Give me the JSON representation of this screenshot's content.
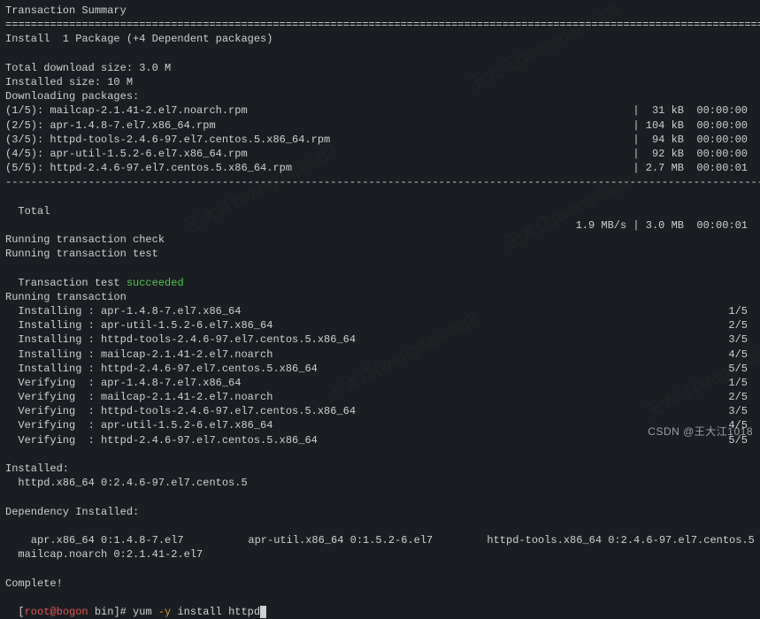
{
  "header": "Transaction Summary",
  "sep_double": "================================================================================================================================",
  "sep_dash": "--------------------------------------------------------------------------------------------------------------------------------",
  "install_line": "Install  1 Package (+4 Dependent packages)",
  "download_size": "Total download size: 3.0 M",
  "installed_size": "Installed size: 10 M",
  "downloading": "Downloading packages:",
  "pkgs": [
    {
      "idx": "(1/5):",
      "name": "mailcap-2.1.41-2.el7.noarch.rpm",
      "size": " 31 kB",
      "time": "00:00:00"
    },
    {
      "idx": "(2/5):",
      "name": "apr-1.4.8-7.el7.x86_64.rpm",
      "size": "104 kB",
      "time": "00:00:00"
    },
    {
      "idx": "(3/5):",
      "name": "httpd-tools-2.4.6-97.el7.centos.5.x86_64.rpm",
      "size": " 94 kB",
      "time": "00:00:00"
    },
    {
      "idx": "(4/5):",
      "name": "apr-util-1.5.2-6.el7.x86_64.rpm",
      "size": " 92 kB",
      "time": "00:00:00"
    },
    {
      "idx": "(5/5):",
      "name": "httpd-2.4.6-97.el7.centos.5.x86_64.rpm",
      "size": "2.7 MB",
      "time": "00:00:01"
    }
  ],
  "total_label": "Total",
  "total_stats": "1.9 MB/s | 3.0 MB  00:00:01",
  "run_check": "Running transaction check",
  "run_test": "Running transaction test",
  "test_prefix": "Transaction test ",
  "test_status": "succeeded",
  "run_trans": "Running transaction",
  "ops": [
    {
      "act": "  Installing : ",
      "pkg": "apr-1.4.8-7.el7.x86_64",
      "prog": "1/5"
    },
    {
      "act": "  Installing : ",
      "pkg": "apr-util-1.5.2-6.el7.x86_64",
      "prog": "2/5"
    },
    {
      "act": "  Installing : ",
      "pkg": "httpd-tools-2.4.6-97.el7.centos.5.x86_64",
      "prog": "3/5"
    },
    {
      "act": "  Installing : ",
      "pkg": "mailcap-2.1.41-2.el7.noarch",
      "prog": "4/5"
    },
    {
      "act": "  Installing : ",
      "pkg": "httpd-2.4.6-97.el7.centos.5.x86_64",
      "prog": "5/5"
    },
    {
      "act": "  Verifying  : ",
      "pkg": "apr-1.4.8-7.el7.x86_64",
      "prog": "1/5"
    },
    {
      "act": "  Verifying  : ",
      "pkg": "mailcap-2.1.41-2.el7.noarch",
      "prog": "2/5"
    },
    {
      "act": "  Verifying  : ",
      "pkg": "httpd-tools-2.4.6-97.el7.centos.5.x86_64",
      "prog": "3/5"
    },
    {
      "act": "  Verifying  : ",
      "pkg": "apr-util-1.5.2-6.el7.x86_64",
      "prog": "4/5"
    },
    {
      "act": "  Verifying  : ",
      "pkg": "httpd-2.4.6-97.el7.centos.5.x86_64",
      "prog": "5/5"
    }
  ],
  "installed_hdr": "Installed:",
  "installed_pkg": "  httpd.x86_64 0:2.4.6-97.el7.centos.5",
  "dep_hdr": "Dependency Installed:",
  "dep_line1a": "  apr.x86_64 0:1.4.8-7.el7",
  "dep_line1b": "apr-util.x86_64 0:1.5.2-6.el7",
  "dep_line1c": "httpd-tools.x86_64 0:2.4.6-97.el7.centos.5",
  "dep_line2": "  mailcap.noarch 0:2.1.41-2.el7",
  "complete": "Complete!",
  "prompt_user": "root@bogon",
  "prompt_dir": " bin",
  "prompt_hash": "]# ",
  "cmd_yum": "yum ",
  "cmd_flag": "-y",
  "cmd_rest": " install httpd",
  "footer": "CSDN @王大江1018",
  "wm": "王大江(wangdajiang3"
}
